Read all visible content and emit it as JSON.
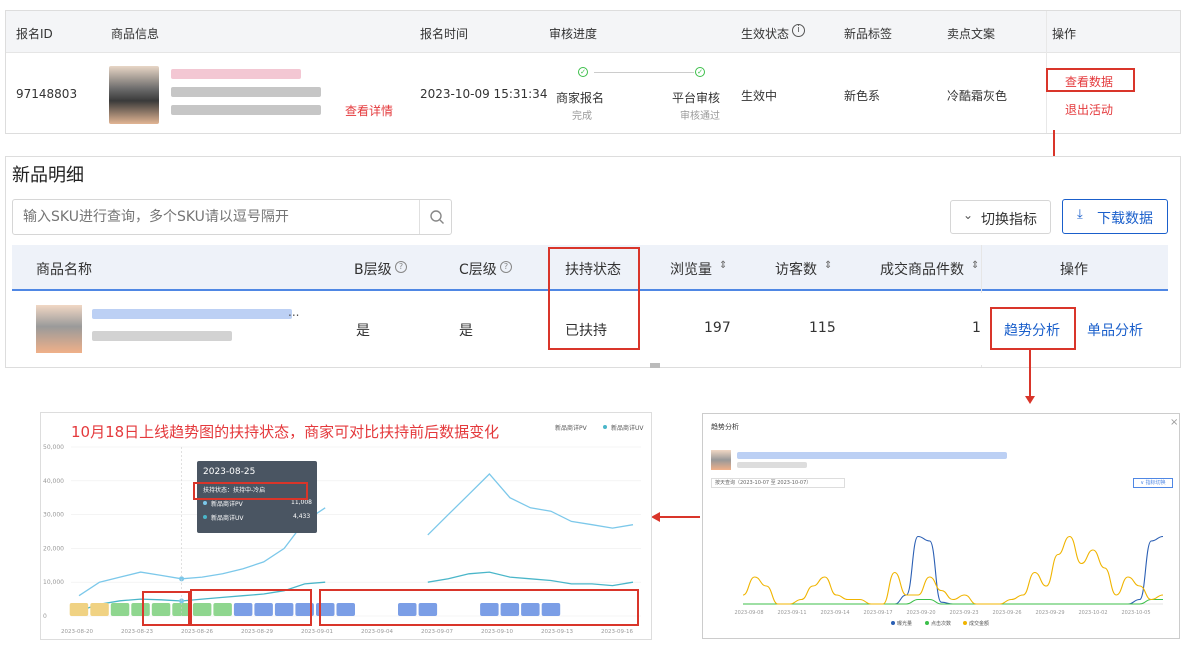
{
  "top": {
    "headers": [
      "报名ID",
      "商品信息",
      "报名时间",
      "审核进度",
      "生效状态",
      "新品标签",
      "卖点文案",
      "操作"
    ],
    "info_icon": "info-circle-icon",
    "row": {
      "id": "97148803",
      "view_detail": "查看详情",
      "time": "2023-10-09 15:31:34",
      "step1_label": "商家报名",
      "step1_sub": "完成",
      "step2_label": "平台审核",
      "step2_sub": "审核通过",
      "status": "生效中",
      "tag": "新色系",
      "copy": "冷酷霜灰色",
      "action_view": "查看数据",
      "action_exit": "退出活动"
    }
  },
  "detail": {
    "title": "新品明细",
    "search_placeholder": "输入SKU进行查询，多个SKU请以逗号隔开",
    "switch_label": "切换指标",
    "download_label": "下载数据",
    "headers": [
      "商品名称",
      "B层级",
      "C层级",
      "扶持状态",
      "浏览量",
      "访客数",
      "成交商品件数",
      "操作"
    ],
    "row": {
      "b_level": "是",
      "c_level": "是",
      "support": "已扶持",
      "pv": "197",
      "uv": "115",
      "orders": "1",
      "trend": "趋势分析",
      "single": "单品分析"
    }
  },
  "annotation": "10月18日上线趋势图的扶持状态，商家可对比扶持前后数据变化",
  "left_chart": {
    "legend": [
      "新品商详PV",
      "新品商详UV"
    ],
    "tooltip": {
      "date": "2023-08-25",
      "status": "扶持状态：扶持中-冷启",
      "pv_label": "新品商详PV",
      "pv_value": "11,008",
      "uv_label": "新品商详UV",
      "uv_value": "4,433"
    }
  },
  "right_chart": {
    "title": "趋势分析",
    "close": "×",
    "date_range": "按天查询（2023-10-07 至 2023-10-07）",
    "switch": "∨ 指标切换",
    "legend": [
      "曝光量",
      "点击次数",
      "成交金额"
    ]
  },
  "chart_data": [
    {
      "type": "line",
      "title": "",
      "y_ticks": [
        "0",
        "10,000",
        "20,000",
        "30,000",
        "40,000",
        "50,000"
      ],
      "x_ticks": [
        "2023-08-20",
        "2023-08-23",
        "2023-08-26",
        "2023-08-29",
        "2023-09-01",
        "2023-09-04",
        "2023-09-07",
        "2023-09-10",
        "2023-09-13",
        "2023-09-16"
      ],
      "ylim": [
        0,
        50000
      ],
      "x": [
        "08-20",
        "08-21",
        "08-22",
        "08-23",
        "08-24",
        "08-25",
        "08-26",
        "08-27",
        "08-28",
        "08-29",
        "08-30",
        "08-31",
        "09-01",
        "09-02",
        "09-03",
        "09-04",
        "09-05",
        "09-06",
        "09-07",
        "09-08",
        "09-09",
        "09-10",
        "09-11",
        "09-12",
        "09-13",
        "09-14",
        "09-15",
        "09-16"
      ],
      "series": [
        {
          "name": "新品商详PV",
          "color": "#7cc8ea",
          "values": [
            6000,
            10000,
            11500,
            13000,
            12000,
            11000,
            11500,
            12500,
            14000,
            16000,
            20000,
            28000,
            32000,
            null,
            null,
            null,
            null,
            24000,
            30000,
            36000,
            42000,
            35000,
            32000,
            31000,
            28000,
            27000,
            26000,
            27000
          ]
        },
        {
          "name": "新品商详UV",
          "color": "#4ab6c9",
          "values": [
            1500,
            3500,
            4500,
            5000,
            4800,
            4433,
            5000,
            5500,
            6000,
            6500,
            7500,
            9500,
            10000,
            null,
            null,
            null,
            null,
            10000,
            11000,
            12500,
            13000,
            11500,
            11000,
            10500,
            9500,
            9500,
            9000,
            10000
          ]
        }
      ],
      "support_states": [
        {
          "days": 2,
          "color": "#f0d283"
        },
        {
          "days": 6,
          "color": "#8fd68f"
        },
        {
          "days": 16,
          "color": "#7b9ee6"
        }
      ],
      "grid": true,
      "legend_position": "top-right"
    },
    {
      "type": "line",
      "title": "",
      "x_ticks": [
        "2023-09-08",
        "2023-09-11",
        "2023-09-14",
        "2023-09-17",
        "2023-09-20",
        "2023-09-23",
        "2023-09-26",
        "2023-09-29",
        "2023-10-02",
        "2023-10-05"
      ],
      "series": [
        {
          "name": "曝光量",
          "color": "#2b5fb4",
          "values": [
            0,
            0,
            0,
            0,
            0,
            0,
            0,
            0,
            0,
            0,
            0,
            0,
            0,
            0,
            0.1,
            0.75,
            0.7,
            0.02,
            0,
            0,
            0,
            0,
            0,
            0,
            0,
            0,
            0,
            0,
            0,
            0,
            0,
            0,
            0,
            0,
            0.05,
            0.7,
            0.75
          ]
        },
        {
          "name": "点击次数",
          "color": "#3cbf4a",
          "values": [
            0,
            0,
            0,
            0,
            0,
            0,
            0,
            0,
            0,
            0,
            0,
            0,
            0,
            0,
            0,
            0.05,
            0.05,
            0,
            0,
            0,
            0,
            0,
            0,
            0,
            0,
            0,
            0,
            0,
            0,
            0,
            0,
            0,
            0,
            0,
            0,
            0.05,
            0.05
          ]
        },
        {
          "name": "成交金额",
          "color": "#f0b400",
          "values": [
            0.1,
            0.3,
            0.2,
            0,
            0,
            0.05,
            0.2,
            0.3,
            0.1,
            0.05,
            0.05,
            0,
            0,
            0.35,
            0.1,
            0.1,
            0.3,
            0.15,
            0.05,
            0.1,
            0,
            0,
            0,
            0.05,
            0.1,
            0.35,
            0.2,
            0.55,
            0.75,
            0.45,
            0.6,
            0.4,
            0.1,
            0.3,
            0.2,
            0.05,
            0.1
          ]
        }
      ],
      "grid": false,
      "legend_position": "bottom"
    }
  ]
}
